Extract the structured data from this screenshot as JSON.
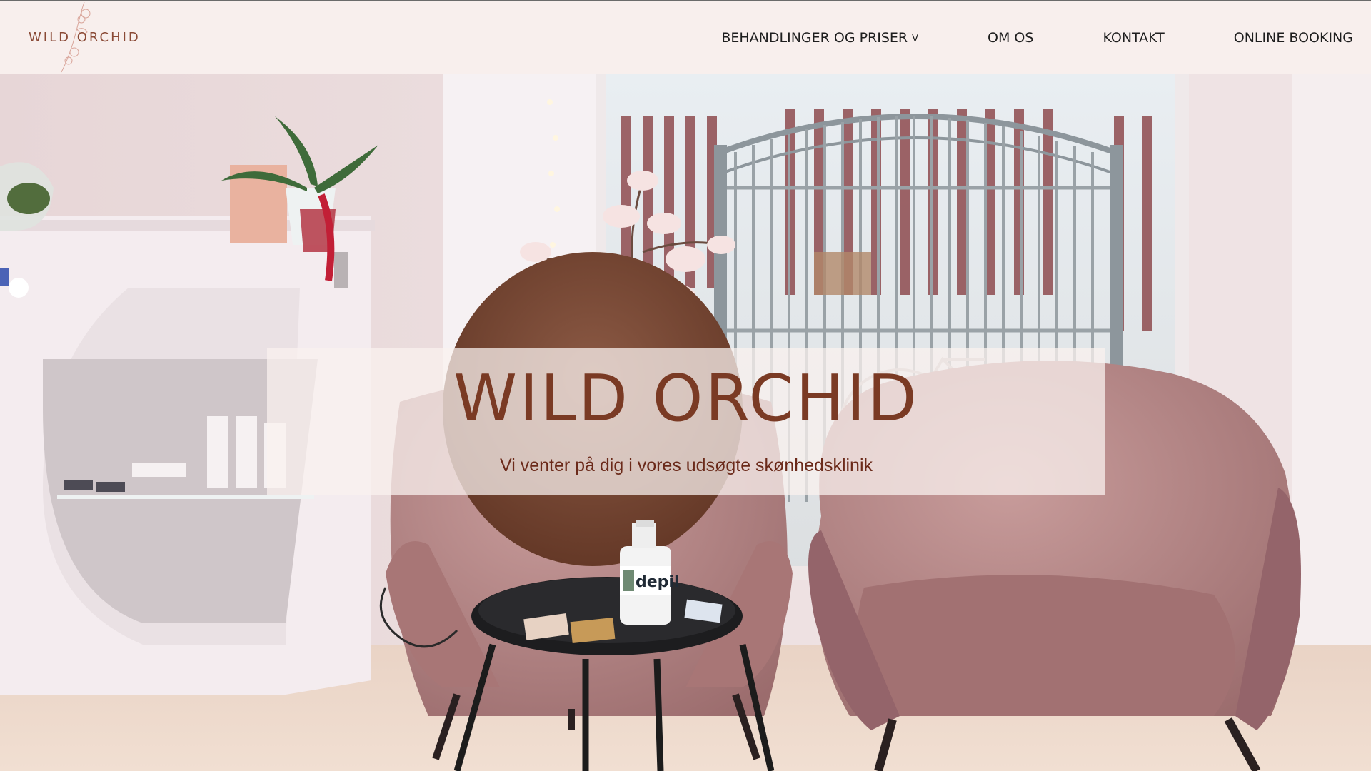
{
  "brand": {
    "logo_text": "WILD ORCHID",
    "logo_icon": "orchid-flower-icon"
  },
  "nav": {
    "items": [
      {
        "label": "BEHANDLINGER OG PRISER",
        "has_dropdown": true,
        "dropdown_glyph": "v"
      },
      {
        "label": "OM OS"
      },
      {
        "label": "KONTAKT"
      },
      {
        "label": "ONLINE BOOKING"
      }
    ]
  },
  "hero": {
    "title": "WILD ORCHID",
    "subtitle": "Vi venter på dig i vores udsøgte skønhedsklinik",
    "product_label": "depil"
  },
  "colors": {
    "header_bg": "#f8efed",
    "brand_brown": "#7a3a24",
    "nav_text": "#1e1e1e",
    "chair_pink": "#b88584"
  }
}
